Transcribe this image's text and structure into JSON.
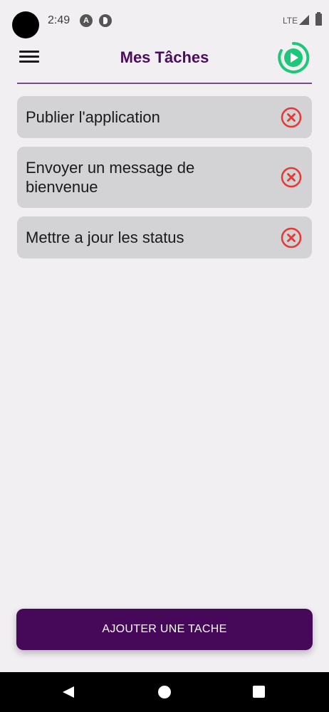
{
  "status_bar": {
    "time": "2:49",
    "network": "LTE"
  },
  "header": {
    "title": "Mes Tâches",
    "accent_color": "#4a0e5c",
    "play_icon_color": "#1ec87a"
  },
  "tasks": [
    {
      "label": "Publier l'application"
    },
    {
      "label": "Envoyer un message de bienvenue"
    },
    {
      "label": "Mettre a jour les status"
    }
  ],
  "delete_icon_color": "#e53935",
  "add_button": {
    "label": "AJOUTER UNE TACHE",
    "color": "#46095a"
  }
}
